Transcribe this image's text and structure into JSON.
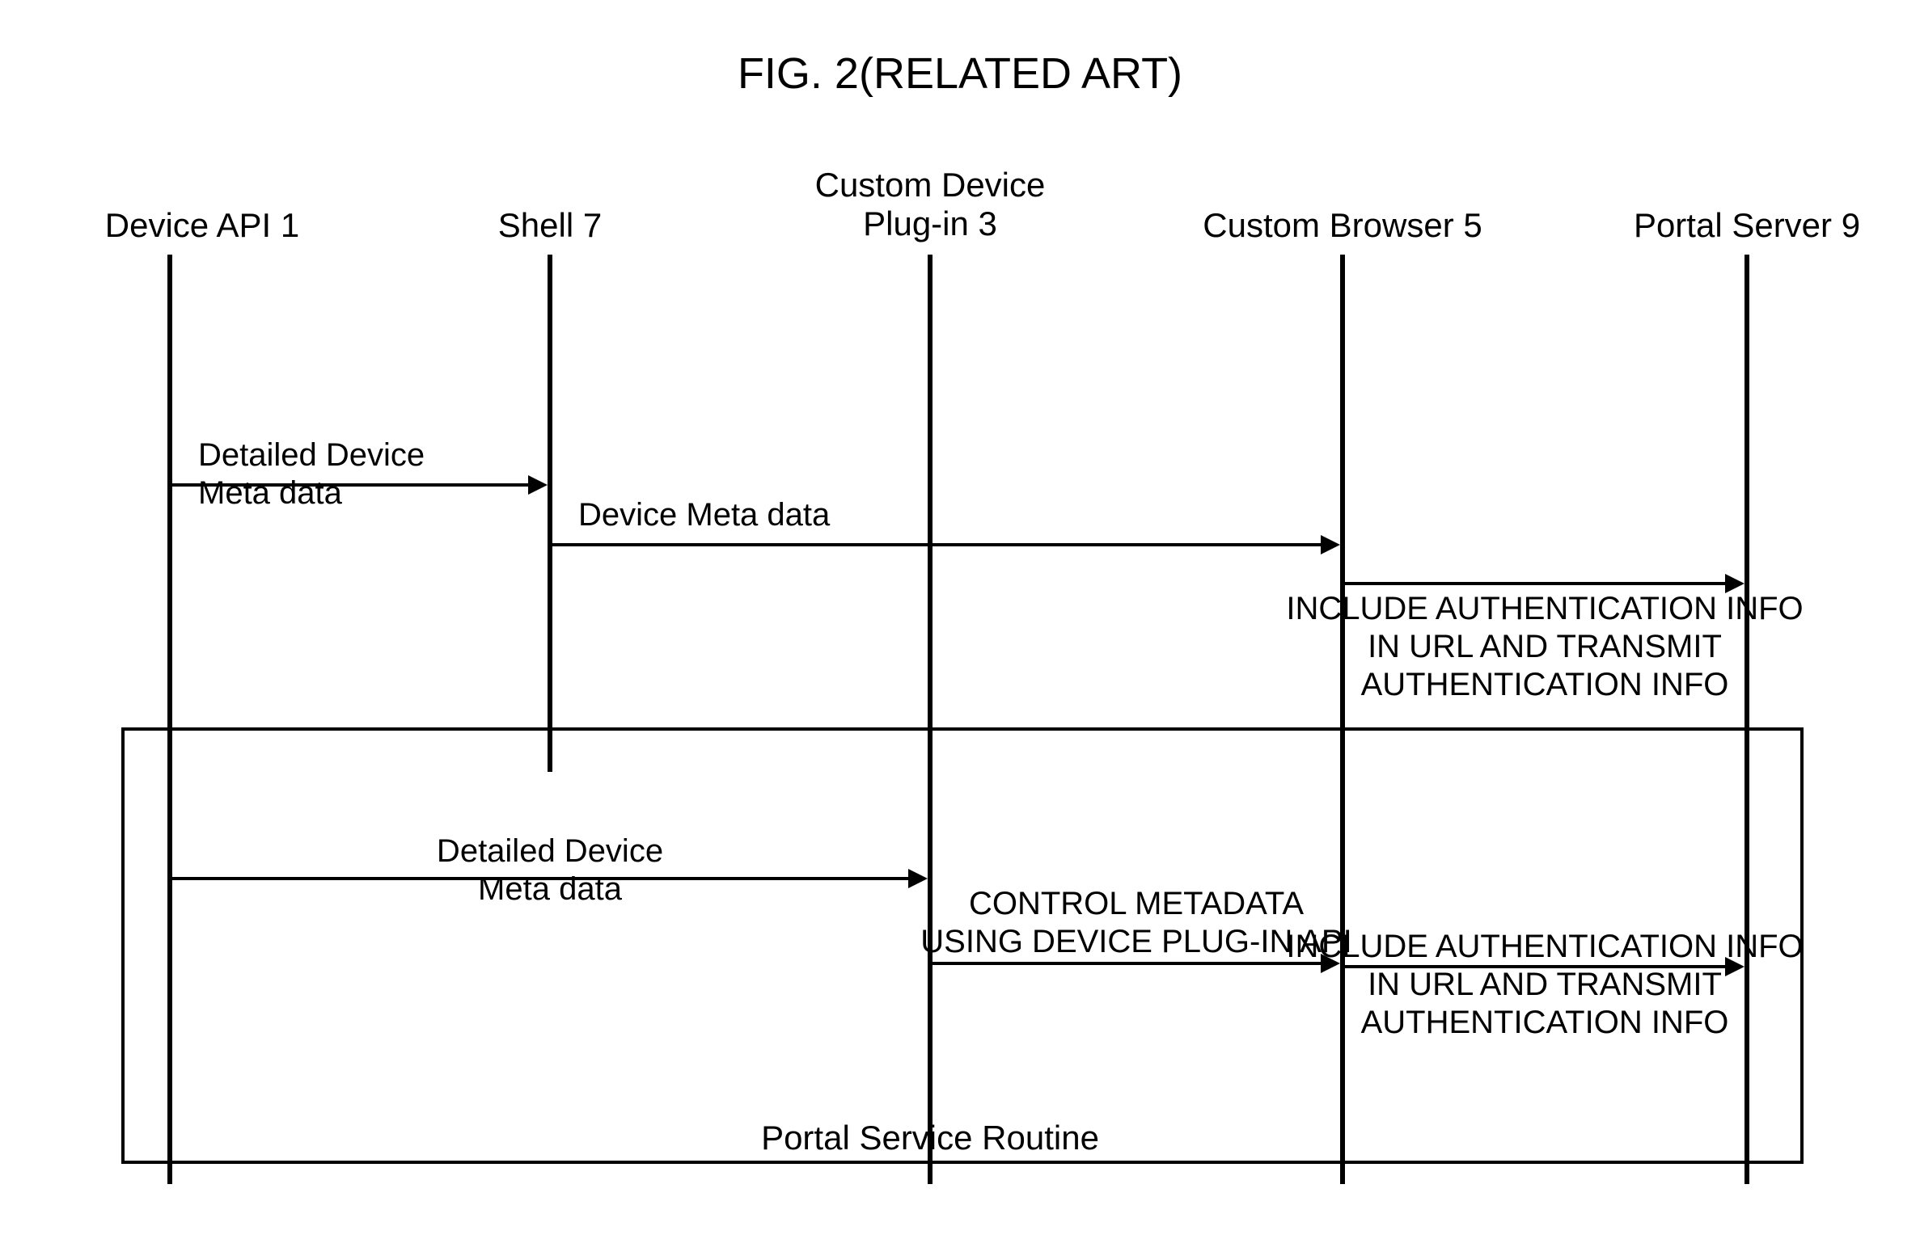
{
  "title": "FIG. 2(RELATED ART)",
  "lanes": {
    "deviceApi": {
      "label": "Device API 1"
    },
    "shell": {
      "label": "Shell 7"
    },
    "plugin": {
      "label": "Custom Device\nPlug-in 3"
    },
    "browser": {
      "label": "Custom Browser 5"
    },
    "portal": {
      "label": "Portal Server 9"
    }
  },
  "messages": {
    "m1": "Detailed Device\nMeta data",
    "m2": "Device Meta data",
    "m3": "INCLUDE AUTHENTICATION INFO\nIN URL AND TRANSMIT\nAUTHENTICATION INFO",
    "m4": "Detailed Device\nMeta data",
    "m5": "CONTROL METADATA\nUSING DEVICE PLUG-IN API",
    "m6": "INCLUDE AUTHENTICATION INFO\nIN URL AND TRANSMIT\nAUTHENTICATION INFO"
  },
  "frame": {
    "label": "Portal Service Routine"
  }
}
